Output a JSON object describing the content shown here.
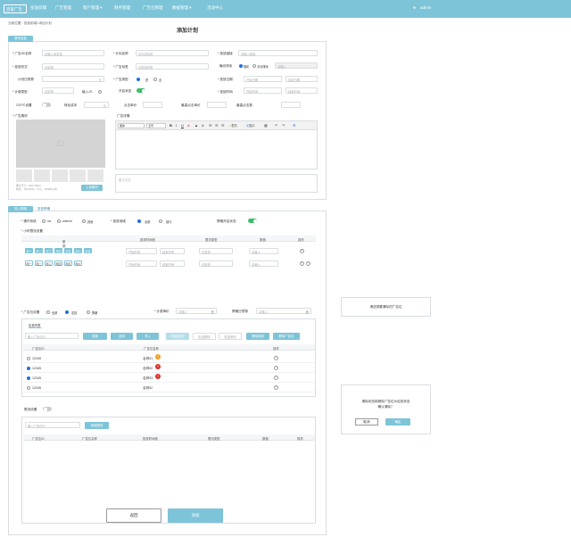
{
  "nav": {
    "logo": "百家广告",
    "items": [
      "投放前端",
      "广告管理",
      "客户管理 ▾",
      "财务管理",
      "广告位管理",
      "数据管理 ▾",
      "活动中心"
    ],
    "user": "admin"
  },
  "breadcrumb": "当前位置：投放前端>添加计划",
  "page_title": "添加计划",
  "basic": {
    "tab": "基本信息",
    "ad_name_label": "* 广告ID/名称",
    "ad_name_ph": "请输入或选择",
    "plan_name_label": "* 计划名称",
    "plan_name_ph": "请分类名称",
    "link_label": "* 投放链接",
    "link_ph": "请输入链接",
    "form_label": "* 投放形式",
    "form_ph": "请选择",
    "tag_label": "* 广告标签",
    "tag_ph": "请选择标签",
    "expose_label": "曝光排序",
    "expose_opt1": "随机",
    "expose_opt2": "手动排序",
    "expose_ph": "请输入",
    "budget_label": "计划日预算",
    "budget_unit": "元",
    "type_label": "* 广告类型",
    "type_opt1": "是",
    "type_opt2": "否",
    "date_label": "* 投放日期",
    "date_start": "开始日期",
    "date_end": "结束日期",
    "fee_label": "* 计费类型",
    "fee_ph": "请选择",
    "js_label": "植入JS",
    "open_label": "开启状态",
    "time_label": "* 投放时间",
    "time_start": "开始时间",
    "time_end": "结束时间",
    "ocpc_label": "OCPC设置",
    "conv_label": "转化成本",
    "conv_unit": "元",
    "click_label": "点击单价",
    "min_label": "最高点击单价",
    "maxcnt_label": "最高点击数",
    "material_label": "* 广告素材",
    "upload_hint": "图片尺寸：640×750px",
    "upload_hint2": "格式：JPG/PNG，大小：200KB以内",
    "upload_btn": "上传素材",
    "detail_label": "广告详情",
    "editor_font": "黑体",
    "editor_size": "五号",
    "editor_b": "B",
    "editor_i": "I",
    "editor_u": "U",
    "editor_emoji": "表情",
    "editor_img": "图片",
    "remark_ph": "备注内容"
  },
  "targeting": {
    "tab1": "投入策略",
    "tab2": "投放策略",
    "os_label": "* 操作系统",
    "os_opts": [
      "ios",
      "android",
      "其他"
    ],
    "region_label": "* 投放地域",
    "region_opts": [
      "全部",
      "部分"
    ],
    "strategy_label": "策略开启状态",
    "hour_label": "* 小时限流设置",
    "hour_cols": [
      "星期",
      "投放时间段",
      "限流类型",
      "数值",
      "操作"
    ],
    "days1": [
      "周一",
      "周二",
      "周三",
      "周四",
      "周五",
      "周六",
      "周日"
    ],
    "days2": [
      "周一",
      "周二",
      "周三",
      "周四",
      "周五",
      "周六"
    ],
    "time_start": "开始时间",
    "time_end": "结束时间",
    "flow_ph": "请选择",
    "num_ph": "请输入",
    "adpos_label": "* 广告位设置",
    "adpos_opts": [
      "全部",
      "定投",
      "屏蔽"
    ],
    "fee_label": "* 计费单价",
    "fee_ph": "请输入",
    "fee_unit": "元",
    "daybudget_label": "策略日预算",
    "daybudget_ph": "请输入",
    "daybudget_unit": "元",
    "list_tab": "定投列表",
    "search_ph": "输入广告位ID",
    "btns": [
      "搜索",
      "选择",
      "导入",
      "批量添加",
      "批量删除",
      "批量修改",
      "删除选择",
      "删除广告位"
    ],
    "list_cols": [
      "广告位ID",
      "广告位名称",
      "操作"
    ],
    "rows": [
      {
        "id": "12345",
        "name": "名称01",
        "checked": false,
        "badge": "!",
        "badge_color": "#f0a020"
      },
      {
        "id": "12345",
        "name": "名称02",
        "checked": true,
        "badge": "!",
        "badge_color": "#d9302c"
      },
      {
        "id": "12345",
        "name": "名称03",
        "checked": true,
        "badge": "!",
        "badge_color": "#d9302c"
      },
      {
        "id": "12345",
        "name": "名称02",
        "checked": false,
        "badge": "",
        "badge_color": ""
      }
    ],
    "flow_label": "限流设置",
    "flow_search_ph": "输入广告位ID",
    "flow_btn": "新增限流",
    "flow_cols": [
      "广告位ID",
      "广告位名称",
      "投放时间段",
      "限流类型",
      "数值",
      "操作"
    ]
  },
  "footer": {
    "back": "返回",
    "submit": "添加"
  },
  "side": {
    "hint": "请选择要清除的广告位",
    "confirm_text1": "清除状态将删除广告位为定投状态",
    "confirm_text2": "确认清除？",
    "cancel": "取消",
    "ok": "确定"
  },
  "colors": {
    "accent": "#7ec4d8",
    "primary": "#1e6fd9",
    "toggle": "#3bbf67"
  }
}
